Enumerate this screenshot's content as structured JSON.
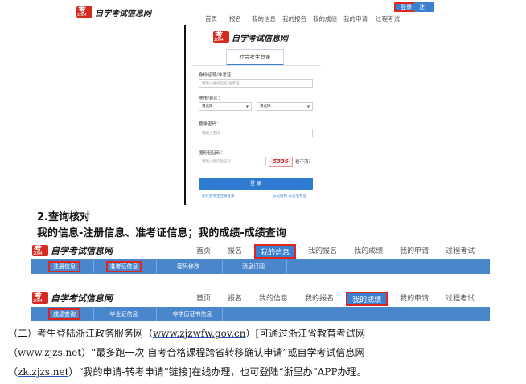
{
  "site": {
    "logo_text": "自学考试信息网",
    "badge_glyph": "考",
    "badge_year": "2004"
  },
  "top_nav": {
    "items": [
      "首页",
      "报名",
      "我的信息",
      "我的报名",
      "我的成绩",
      "我的申请",
      "过程考试"
    ],
    "login_button": "登录",
    "register_button": "注册"
  },
  "login_form": {
    "tab_label": "社会考生登录",
    "id_label": "身份证号/准考证：",
    "id_placeholder": "请输入身份证号/准考证",
    "region_label": "地市/县区：",
    "region_select_1": "请选择",
    "region_select_2": "请选择",
    "password_label": "登录密码：",
    "password_placeholder": "请输入密码",
    "captcha_label": "图形验证码：",
    "captcha_placeholder": "请输入图形验证码",
    "captcha_value": "5336",
    "captcha_refresh": "看不清？",
    "submit_label": "登 录",
    "footer_left": "新社会考生注册登录",
    "footer_right": "忘记密码  忘记准考证"
  },
  "heading": {
    "number": "2.查询核对",
    "line": "我的信息-注册信息、准考证信息；我的成绩-成绩查询"
  },
  "strip_info": {
    "nav_items": [
      "首页",
      "报名",
      "我的信息",
      "我的报名",
      "我的成绩",
      "我的申请",
      "过程考试"
    ],
    "active": "我的信息",
    "sub_items": [
      "注册信息",
      "准考证信息",
      "密码修改",
      "消息订阅"
    ],
    "highlighted_sub": [
      "注册信息",
      "准考证信息"
    ]
  },
  "strip_score": {
    "nav_items": [
      "首页",
      "报名",
      "我的信息",
      "我的报名",
      "我的成绩",
      "我的申请",
      "过程考试"
    ],
    "active": "我的成绩",
    "sub_items": [
      "成绩查询",
      "毕业证信息",
      "非学历证书信息"
    ],
    "highlighted_sub": [
      "成绩查询"
    ]
  },
  "paragraph": {
    "line1_pre": "（二）考生登陆浙江政务服务网（",
    "line1_link": "www.zjzwfw.gov.cn",
    "line1_post": "）[可通过浙江省教育考试网",
    "line2_pre": "（",
    "line2_link": "www.zjzs.net",
    "line2_post": "）“最多跑一次-自考合格课程跨省转移确认申请”或自学考试信息网",
    "line3_pre": "（",
    "line3_link": "zk.zjzs.net",
    "line3_post": "）“我的申请-转考申请”链接]在线办理，也可登陆“浙里办”APP办理。"
  },
  "colors": {
    "primary_blue": "#3b7fd0",
    "bar_blue": "#4a86cc",
    "highlight_red": "#e0261c",
    "logo_red": "#d42a20"
  }
}
